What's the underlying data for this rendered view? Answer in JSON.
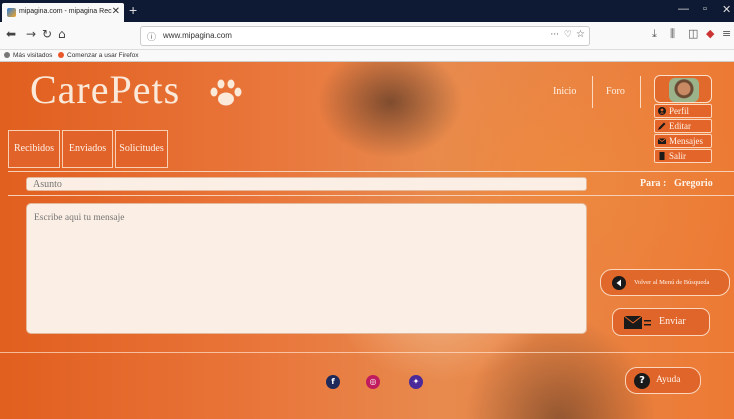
{
  "browser": {
    "tab_title": "mipagina.com - mipagina Rec",
    "url": "www.mipagina.com",
    "bookmarks": [
      "Más visitados",
      "Comenzar a usar Firefox"
    ],
    "nav_icons": [
      "back-icon",
      "forward-icon",
      "reload-icon",
      "home-icon"
    ],
    "toolbar_icons": [
      "download-icon",
      "library-icon",
      "sidebar-icon",
      "addon-icon",
      "menu-icon"
    ]
  },
  "site": {
    "logo": "CarePets",
    "nav": {
      "inicio": "Inicio",
      "foro": "Foro"
    },
    "user_menu": [
      {
        "label": "Perfil",
        "icon": "user-icon"
      },
      {
        "label": "Editar",
        "icon": "pencil-icon"
      },
      {
        "label": "Mensajes",
        "icon": "envelope-icon"
      },
      {
        "label": "Salir",
        "icon": "door-icon"
      }
    ],
    "tabs": [
      "Recibidos",
      "Enviados",
      "Solicitudes"
    ]
  },
  "message": {
    "subject_placeholder": "Asunto",
    "to_label": "Para :",
    "to_value": "Gregorio",
    "body_placeholder": "Escribe aqui tu mensaje"
  },
  "actions": {
    "back": "Volver al Menú de Búsqueda",
    "send": "Enviar",
    "help": "Ayuda"
  },
  "footer": {
    "social": [
      {
        "name": "facebook-icon",
        "glyph": "f",
        "color": "#1f2a5a"
      },
      {
        "name": "instagram-icon",
        "glyph": "◎",
        "color": "#c01b5e"
      },
      {
        "name": "twitter-icon",
        "glyph": "✦",
        "color": "#4a2a9a"
      }
    ]
  }
}
